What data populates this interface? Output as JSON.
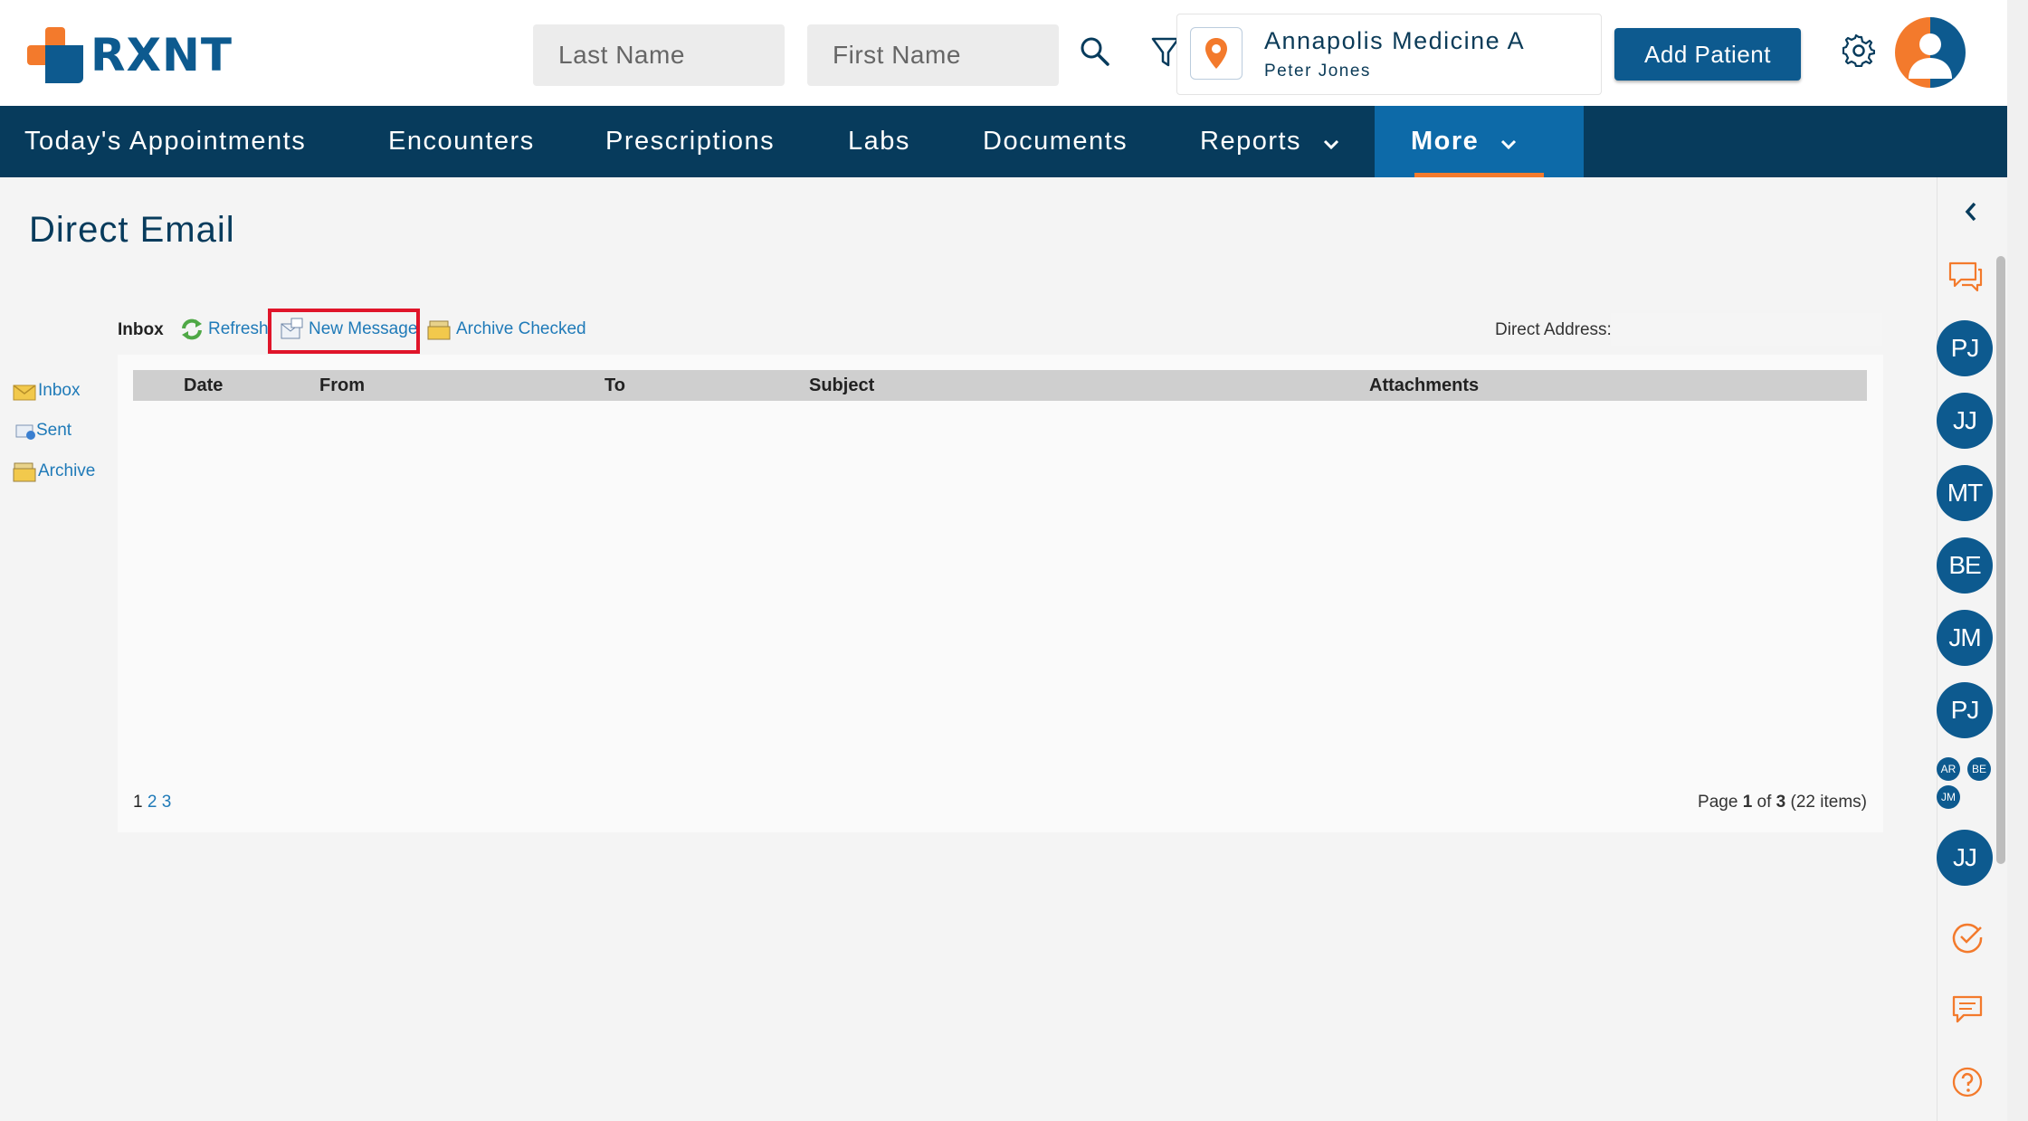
{
  "brand": {
    "logo_text": "RXNT"
  },
  "header": {
    "last_name_placeholder": "Last Name",
    "first_name_placeholder": "First Name",
    "location_name": "Annapolis Medicine A",
    "location_user": "Peter Jones",
    "add_patient_label": "Add Patient"
  },
  "nav": {
    "items": [
      "Today's Appointments",
      "Encounters",
      "Prescriptions",
      "Labs",
      "Documents",
      "Reports",
      "More"
    ],
    "active": "More"
  },
  "page": {
    "title": "Direct Email"
  },
  "folders": [
    "Inbox",
    "Sent",
    "Archive"
  ],
  "toolbar": {
    "current_folder": "Inbox",
    "refresh_label": "Refresh",
    "new_message_label": "New Message",
    "archive_label": "Archive Checked",
    "direct_address_label": "Direct Address:"
  },
  "table": {
    "columns": [
      "Date",
      "From",
      "To",
      "Subject",
      "Attachments"
    ],
    "rows": []
  },
  "pagination": {
    "pages": [
      "1",
      "2",
      "3"
    ],
    "current_page": "1",
    "info_prefix": "Page ",
    "info_current": "1",
    "info_of": " of ",
    "info_total": "3",
    "info_items": " (22 items)"
  },
  "rail": {
    "avatars": [
      "PJ",
      "JJ",
      "MT",
      "BE",
      "JM",
      "PJ"
    ],
    "mini_avatars": [
      "AR",
      "BE",
      "JM"
    ],
    "last_avatar": "JJ"
  },
  "colors": {
    "brand_blue": "#0d5a8f",
    "nav_dark": "#073b5c",
    "accent_orange": "#f37a2c",
    "link_blue": "#1f7ab8",
    "highlight_red": "#e0152a"
  }
}
